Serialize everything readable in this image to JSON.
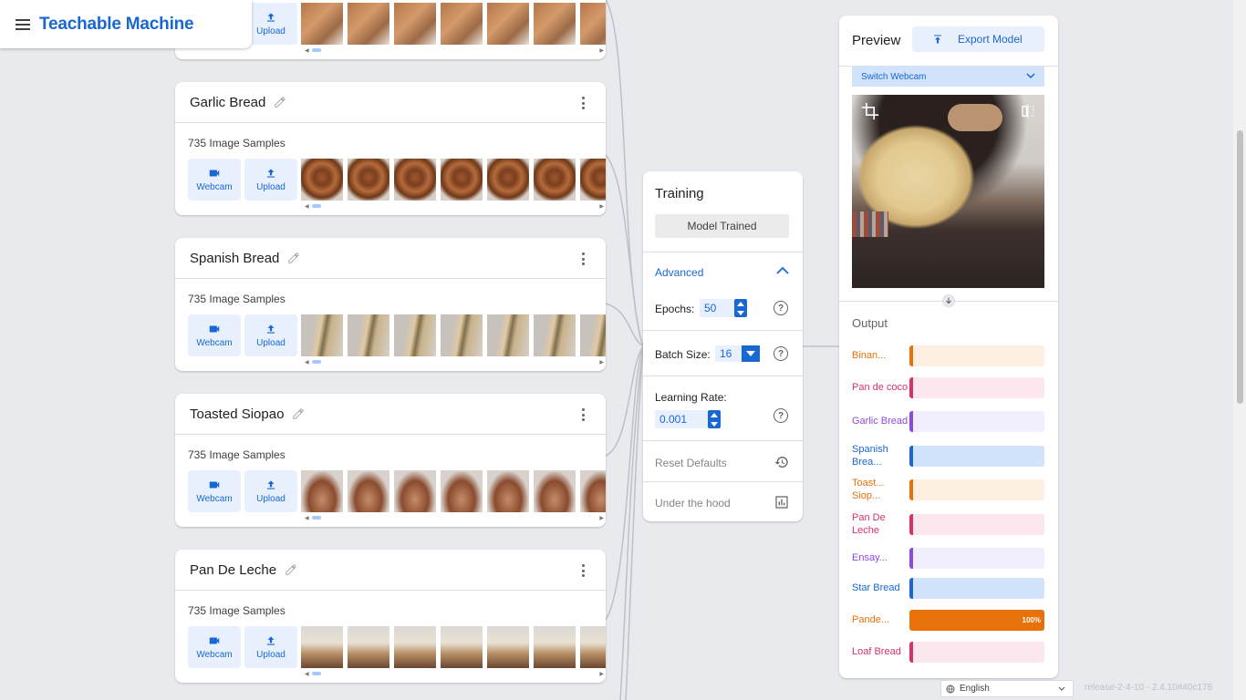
{
  "brand": {
    "title": "Teachable Machine"
  },
  "classes": [
    {
      "name": "",
      "samples": "",
      "webcam_label": "",
      "upload_label": "Upload",
      "thumb_style": "t-crust"
    },
    {
      "name": "Garlic Bread",
      "samples": "735 Image Samples",
      "webcam_label": "Webcam",
      "upload_label": "Upload",
      "thumb_style": "t-garlic"
    },
    {
      "name": "Spanish Bread",
      "samples": "735 Image Samples",
      "webcam_label": "Webcam",
      "upload_label": "Upload",
      "thumb_style": "t-spanish"
    },
    {
      "name": "Toasted Siopao",
      "samples": "735 Image Samples",
      "webcam_label": "Webcam",
      "upload_label": "Upload",
      "thumb_style": "t-siopao"
    },
    {
      "name": "Pan De Leche",
      "samples": "735 Image Samples",
      "webcam_label": "Webcam",
      "upload_label": "Upload",
      "thumb_style": "t-leche"
    }
  ],
  "training": {
    "title": "Training",
    "status_button": "Model Trained",
    "advanced_label": "Advanced",
    "epochs_label": "Epochs:",
    "epochs_value": "50",
    "batch_label": "Batch Size:",
    "batch_value": "16",
    "lr_label": "Learning Rate:",
    "lr_value": "0.001",
    "reset_label": "Reset Defaults",
    "hood_label": "Under the hood",
    "help_glyph": "?"
  },
  "preview": {
    "title": "Preview",
    "export_label": "Export Model",
    "switch_webcam": "Switch Webcam",
    "output_label": "Output",
    "outputs": [
      {
        "label": "Binan...",
        "color": "#e8710a",
        "bg": "#feefe3",
        "value": 0,
        "value_label": ""
      },
      {
        "label": "Pan de coco",
        "color": "#d93070",
        "bg": "#fde7ef",
        "value": 0,
        "value_label": ""
      },
      {
        "label": "Garlic Bread",
        "color": "#8f49e0",
        "bg": "#f1eefd",
        "value": 0,
        "value_label": ""
      },
      {
        "label": "Spanish Brea...",
        "color": "#1967d2",
        "bg": "#d2e3fc",
        "value": 0,
        "value_label": ""
      },
      {
        "label": "Toast... Siop...",
        "color": "#e8710a",
        "bg": "#feefe3",
        "value": 0,
        "value_label": ""
      },
      {
        "label": "Pan De Leche",
        "color": "#d93070",
        "bg": "#fde7ef",
        "value": 0,
        "value_label": ""
      },
      {
        "label": "Ensay...",
        "color": "#8f49e0",
        "bg": "#f1eefd",
        "value": 0,
        "value_label": ""
      },
      {
        "label": "Star Bread",
        "color": "#1967d2",
        "bg": "#d2e3fc",
        "value": 0,
        "value_label": ""
      },
      {
        "label": "Pande...",
        "color": "#e8710a",
        "bg": "#feefe3",
        "value": 1.0,
        "value_label": "100%"
      },
      {
        "label": "Loaf Bread",
        "color": "#d93070",
        "bg": "#fde7ef",
        "value": 0,
        "value_label": ""
      }
    ]
  },
  "footer": {
    "language": "English",
    "release": "release-2-4-10 - 2.4.10#40c178"
  },
  "icons": [
    "menu-icon",
    "pencil-icon",
    "more-vert-icon",
    "webcam-icon",
    "upload-icon",
    "chevron-up-icon",
    "help-icon",
    "history-icon",
    "bar-chart-icon",
    "export-icon",
    "chevron-down-icon",
    "crop-icon",
    "flip-icon",
    "arrow-down-icon",
    "globe-icon"
  ]
}
